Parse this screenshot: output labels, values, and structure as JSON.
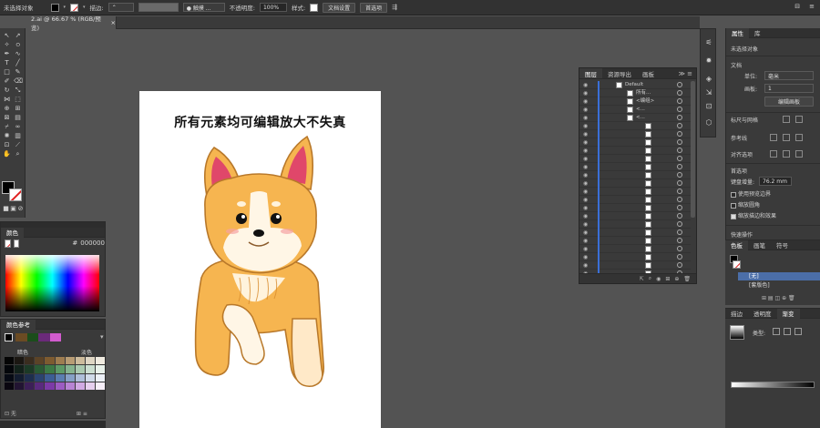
{
  "controlbar": {
    "selection_label": "未选择对象",
    "stroke_label": "描边:",
    "brush_label": "● 触摸 ...",
    "opacity_label": "不透明度:",
    "opacity_value": "100%",
    "style_label": "样式:",
    "doc_setup_button": "文档设置",
    "preferences_button": "首选项"
  },
  "document": {
    "tab_title": "2.ai @ 66.67 % (RGB/预览)",
    "close_glyph": "×"
  },
  "artboard": {
    "headline": "所有元素均可编辑放大不失真"
  },
  "color_panel": {
    "tab": "颜色",
    "hex_prefix": "#",
    "hex_value": "000000"
  },
  "color_guide": {
    "tab": "颜色参考",
    "darker_label": "暗色",
    "lighter_label": "淡色",
    "grid_colors": [
      "#050505",
      "#1b1712",
      "#3a2d1f",
      "#5b4327",
      "#7d5b30",
      "#9e7d50",
      "#b89c74",
      "#cdbb9c",
      "#dfd6c4",
      "#f0ebe0",
      "#04060a",
      "#12211a",
      "#1c3a26",
      "#2a5a34",
      "#3d7a45",
      "#5e9a66",
      "#86b38e",
      "#aac9af",
      "#cbded0",
      "#e8f1ea",
      "#070a14",
      "#131c2f",
      "#1e2e4e",
      "#2b4470",
      "#3c5e94",
      "#5b7eb0",
      "#86a0c6",
      "#aebed9",
      "#d0dae9",
      "#ecf0f7",
      "#0a0610",
      "#221432",
      "#3c1f57",
      "#5a2a7e",
      "#7c3aa7",
      "#9c5cc2",
      "#b884d4",
      "#d1aae3",
      "#e6cfee",
      "#f6eef8"
    ]
  },
  "layers_panel": {
    "tabs": [
      "图层",
      "资源导出",
      "画板"
    ],
    "rows": [
      "Default",
      "所有...",
      "<编组>",
      "<...",
      "<..."
    ]
  },
  "properties_panel": {
    "tabs": [
      "属性",
      "库"
    ],
    "no_selection": "未选择对象",
    "document_label": "文档",
    "units_label": "单位:",
    "units_value": "毫米",
    "artboard_label": "画板:",
    "artboard_value": "1",
    "edit_artboard_button": "编辑画板",
    "rulers_grids_label": "标尺与网格",
    "guides_label": "参考线",
    "snap_label": "对齐选项",
    "preferences_label": "首选项",
    "keyboard_increment_label": "键盘增量:",
    "keyboard_increment_value": "76.2 mm",
    "chk_preview_bounds": "使用预览边界",
    "chk_scale_corners": "缩放圆角",
    "chk_scale_strokes": "缩放描边和效果",
    "quick_actions_label": "快速操作"
  },
  "swatches_panel": {
    "tabs": [
      "色板",
      "画笔",
      "符号"
    ],
    "items": [
      "[无]",
      "[套版色]"
    ]
  },
  "gradient_panel": {
    "tabs": [
      "描边",
      "透明度",
      "渐变"
    ],
    "type_label": "类型:"
  },
  "colors": {
    "ui_bg": "#535353",
    "panel_bg": "#3a3a3a",
    "selection_blue": "#4b6ea8",
    "layer_bar_blue": "#3a6fd8",
    "corgi_orange": "#f6b550"
  }
}
